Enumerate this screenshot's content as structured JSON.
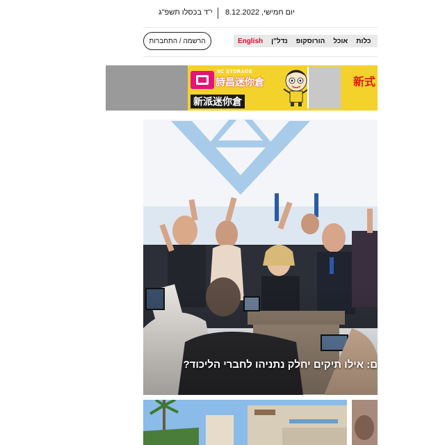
{
  "header": {
    "date_gregorian": "יום חמישי, 8.12.2022",
    "date_hebrew": "י\"ד בכסלו תשפ\"ג"
  },
  "nav": {
    "login_label": "הרשמה / התחברות",
    "items": [
      {
        "label": "English",
        "accent": "#c8102e"
      },
      {
        "label": "נדל\"ן"
      },
      {
        "label": "הורוסקופ"
      },
      {
        "label": "אוכל"
      },
      {
        "label": "כלות"
      }
    ]
  },
  "ad": {
    "brand_en": "SC STORAGE",
    "brand_zh": "詩昌迷你倉",
    "slogan": "新派迷你倉",
    "side_text": "新式"
  },
  "hero": {
    "headline": "ם: אילו תיקים יחלק נתניהו לחברי הליכוד?"
  },
  "colors": {
    "accent_red": "#c8102e",
    "nav_bg": "#e9e9e9",
    "ad_yellow": "#f4d22c",
    "ad_pink": "#e4157a"
  }
}
